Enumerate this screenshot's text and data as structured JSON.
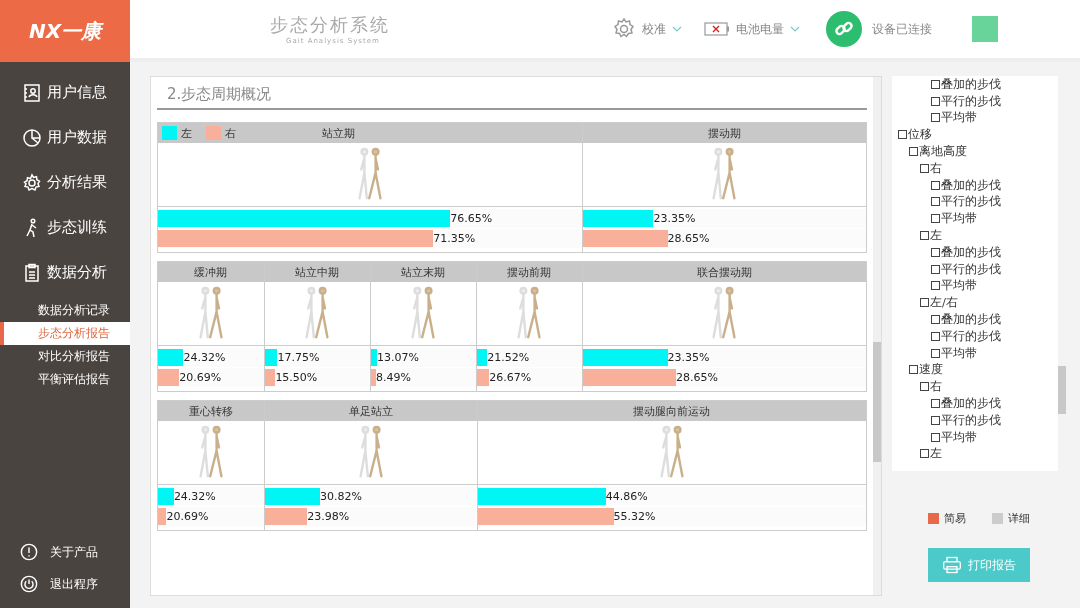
{
  "logo": {
    "text": "NX一康"
  },
  "header": {
    "title": "步态分析系统",
    "subtitle": "Gait Analysis System",
    "calibrate": "校准",
    "battery": "电池电量",
    "device_status": "设备已连接"
  },
  "sidebar": {
    "items": [
      {
        "label": "用户信息",
        "selected": false
      },
      {
        "label": "用户数据",
        "selected": false
      },
      {
        "label": "分析结果",
        "selected": false
      },
      {
        "label": "步态训练",
        "selected": false
      },
      {
        "label": "数据分析",
        "selected": false
      }
    ],
    "sub_items": [
      {
        "label": "数据分析记录",
        "selected": false
      },
      {
        "label": "步态分析报告",
        "selected": true
      },
      {
        "label": "对比分析报告",
        "selected": false
      },
      {
        "label": "平衡评估报告",
        "selected": false
      }
    ],
    "footer": [
      {
        "label": "关于产品"
      },
      {
        "label": "退出程序"
      }
    ]
  },
  "report": {
    "section_title": "2.步态周期概况",
    "legend": [
      {
        "label": "左",
        "color": "#00f5f5"
      },
      {
        "label": "右",
        "color": "#f9b09a"
      }
    ],
    "sections": [
      {
        "cells": [
          {
            "title": "站立期",
            "left": {
              "value": "76.65%",
              "level": 0.69
            },
            "right": {
              "value": "71.35%",
              "level": 0.65
            }
          },
          {
            "title": "摆动期",
            "left": {
              "value": "23.35%",
              "level": 0.25
            },
            "right": {
              "value": "28.65%",
              "level": 0.3
            }
          }
        ]
      },
      {
        "cells": [
          {
            "title": "缓冲期",
            "left": {
              "value": "24.32%",
              "level": 0.24
            },
            "right": {
              "value": "20.69%",
              "level": 0.2
            }
          },
          {
            "title": "站立中期",
            "left": {
              "value": "17.75%",
              "level": 0.12
            },
            "right": {
              "value": "15.50%",
              "level": 0.1
            }
          },
          {
            "title": "站立末期",
            "left": {
              "value": "13.07%",
              "level": 0.06
            },
            "right": {
              "value": "8.49%",
              "level": 0.05
            }
          },
          {
            "title": "摆动前期",
            "left": {
              "value": "21.52%",
              "level": 0.1
            },
            "right": {
              "value": "26.67%",
              "level": 0.12
            }
          },
          {
            "title": "联合摆动期",
            "left": {
              "value": "23.35%",
              "level": 0.3
            },
            "right": {
              "value": "28.65%",
              "level": 0.33
            }
          }
        ]
      },
      {
        "cells": [
          {
            "title": "重心转移",
            "left": {
              "value": "24.32%",
              "level": 0.15
            },
            "right": {
              "value": "20.69%",
              "level": 0.08
            }
          },
          {
            "title": "单足站立",
            "left": {
              "value": "30.82%",
              "level": 0.26
            },
            "right": {
              "value": "23.98%",
              "level": 0.2
            }
          },
          {
            "title": "摆动腿向前运动",
            "left": {
              "value": "44.86%",
              "level": 0.33
            },
            "right": {
              "value": "55.32%",
              "level": 0.35
            }
          }
        ]
      }
    ]
  },
  "tree": {
    "continued_items": [
      {
        "label": "叠加的步伐",
        "checked": false
      },
      {
        "label": "平行的步伐",
        "checked": false
      },
      {
        "label": "平均带",
        "checked": false
      }
    ],
    "items": [
      {
        "label": "位移",
        "checked": false,
        "children": [
          {
            "label": "离地高度",
            "checked": false,
            "children": [
              {
                "label": "右",
                "checked": false,
                "children": [
                  {
                    "label": "叠加的步伐",
                    "checked": false
                  },
                  {
                    "label": "平行的步伐",
                    "checked": false
                  },
                  {
                    "label": "平均带",
                    "checked": false
                  }
                ]
              },
              {
                "label": "左",
                "checked": false,
                "children": [
                  {
                    "label": "叠加的步伐",
                    "checked": false
                  },
                  {
                    "label": "平行的步伐",
                    "checked": false
                  },
                  {
                    "label": "平均带",
                    "checked": false
                  }
                ]
              },
              {
                "label": "左/右",
                "checked": false,
                "children": [
                  {
                    "label": "叠加的步伐",
                    "checked": false
                  },
                  {
                    "label": "平行的步伐",
                    "checked": false
                  },
                  {
                    "label": "平均带",
                    "checked": false
                  }
                ]
              }
            ]
          },
          {
            "label": "速度",
            "checked": false,
            "children": [
              {
                "label": "右",
                "checked": false,
                "children": [
                  {
                    "label": "叠加的步伐",
                    "checked": false
                  },
                  {
                    "label": "平行的步伐",
                    "checked": false
                  },
                  {
                    "label": "平均带",
                    "checked": false
                  }
                ]
              },
              {
                "label": "左",
                "checked": false
              }
            ]
          }
        ]
      }
    ]
  },
  "mode_legend": [
    {
      "label": "简易",
      "color": "#e8694a"
    },
    {
      "label": "详细",
      "color": "#cccccc"
    }
  ],
  "print_button": "打印报告"
}
